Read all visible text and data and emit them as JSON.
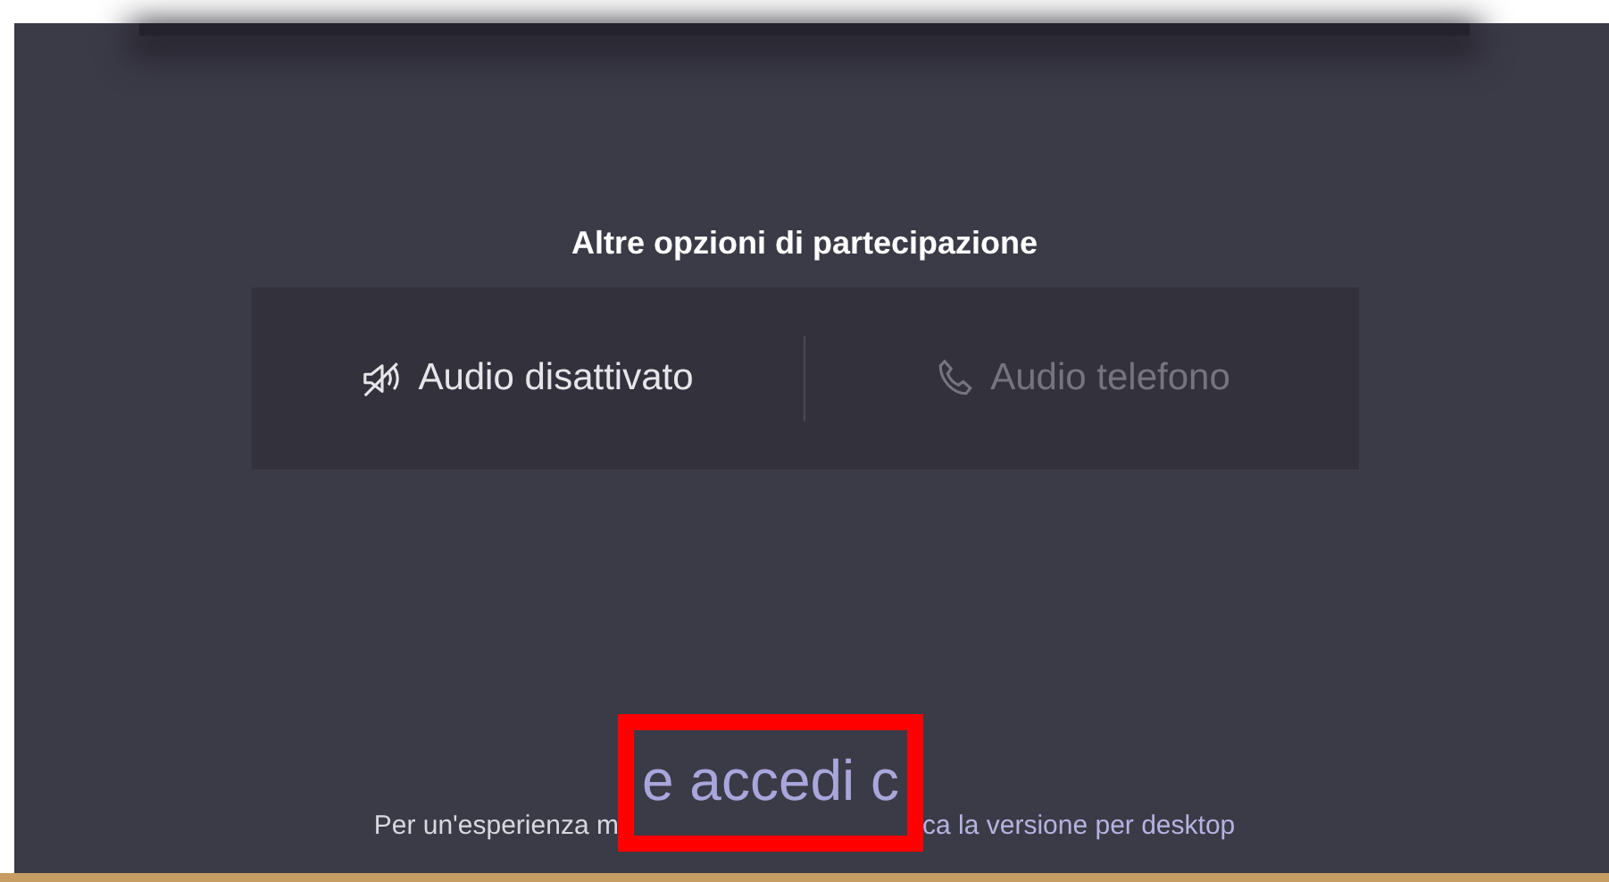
{
  "section_title": "Altre opzioni di partecipazione",
  "options": [
    {
      "kind": "speaker-muted",
      "label": "Audio disattivato",
      "disabled": false
    },
    {
      "kind": "phone",
      "label": "Audio telefono",
      "disabled": true
    }
  ],
  "footer": {
    "prefix": "Per un'esperienza m",
    "link": "ca la versione per desktop"
  },
  "zoom_inset": {
    "text": "e accedi c"
  }
}
